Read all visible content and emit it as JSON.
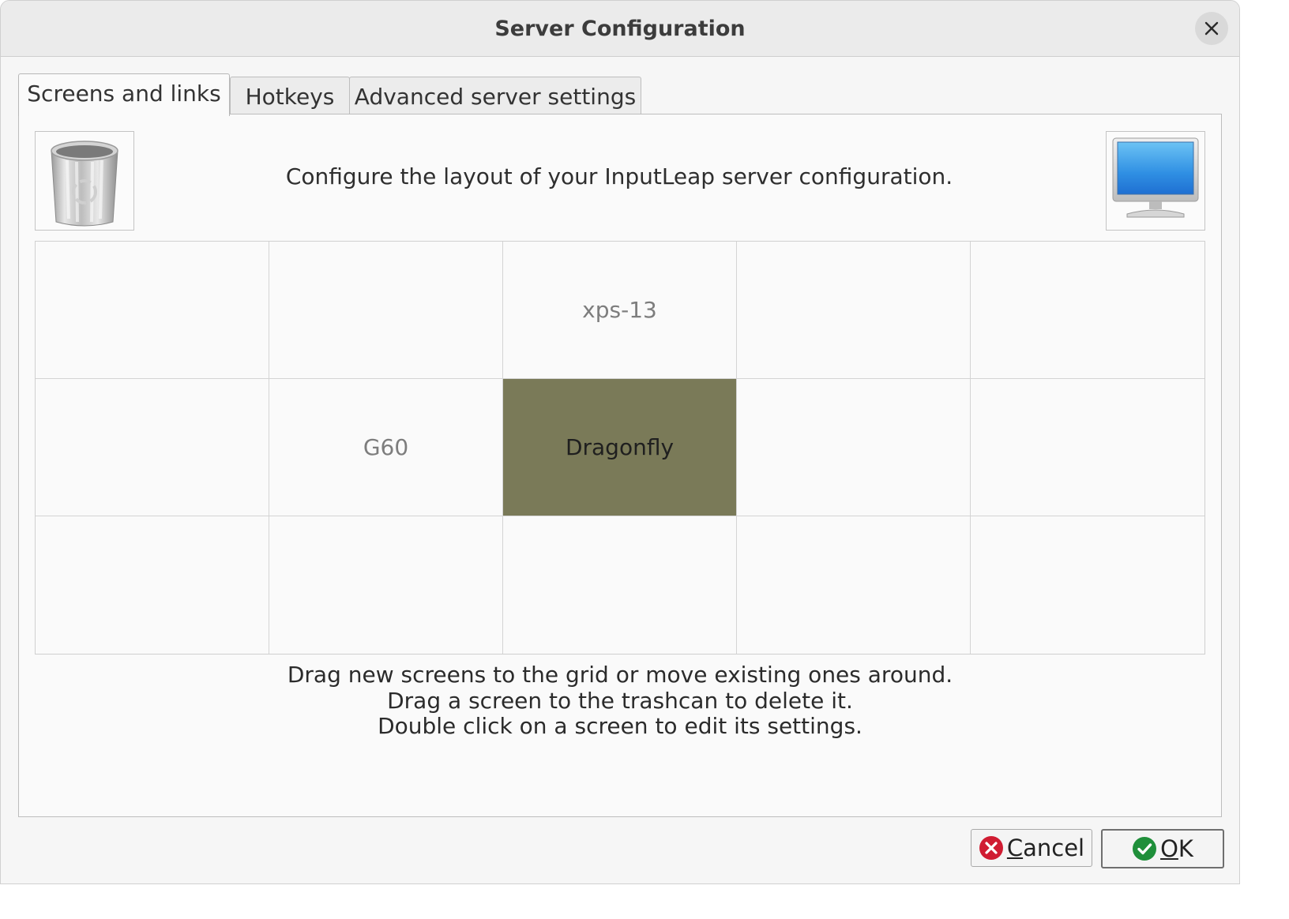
{
  "window": {
    "title": "Server Configuration"
  },
  "tabs": [
    {
      "label": "Screens and links",
      "active": true
    },
    {
      "label": "Hotkeys",
      "active": false
    },
    {
      "label": "Advanced server settings",
      "active": false
    }
  ],
  "screens_tab": {
    "header": "Configure the layout of your InputLeap server configuration.",
    "trash_icon": "trashcan-icon",
    "new_screen_icon": "monitor-icon",
    "grid": [
      [
        "",
        "",
        "xps-13",
        "",
        ""
      ],
      [
        "",
        "G60",
        "Dragonfly",
        "",
        ""
      ],
      [
        "",
        "",
        "",
        "",
        ""
      ]
    ],
    "server_screen": "Dragonfly",
    "help_lines": [
      "Drag new screens to the grid or move existing ones around.",
      "Drag a screen to the trashcan to delete it.",
      "Double click on a screen to edit its settings."
    ]
  },
  "buttons": {
    "cancel": {
      "mnemonic": "C",
      "rest": "ancel",
      "icon": "cancel-icon"
    },
    "ok": {
      "mnemonic": "O",
      "rest": "K",
      "icon": "check-icon"
    }
  },
  "colors": {
    "server_cell": "#7a7a58",
    "cancel_icon": "#d01c32",
    "ok_icon": "#1f8f3a"
  }
}
